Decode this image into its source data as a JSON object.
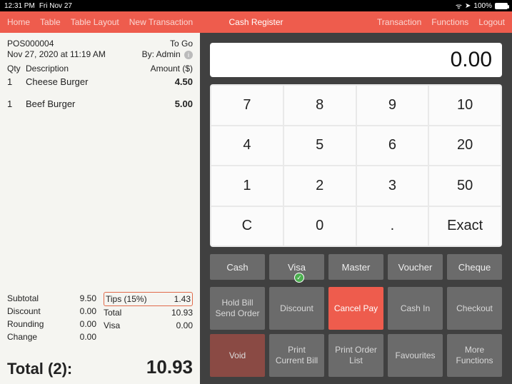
{
  "status": {
    "time": "12:31 PM",
    "date": "Fri Nov 27",
    "battery": "100%"
  },
  "nav": {
    "left": [
      "Home",
      "Table",
      "Table Layout",
      "New Transaction"
    ],
    "title": "Cash Register",
    "right": [
      "Transaction",
      "Functions",
      "Logout"
    ]
  },
  "receipt": {
    "pos_id": "POS000004",
    "order_type": "To Go",
    "datetime": "Nov 27, 2020 at 11:19 AM",
    "by_label": "By: Admin",
    "cols": {
      "qty": "Qty",
      "desc": "Description",
      "amount": "Amount ($)"
    },
    "items": [
      {
        "qty": "1",
        "name": "Cheese Burger",
        "amount": "4.50"
      },
      {
        "qty": "1",
        "name": "Beef Burger",
        "amount": "5.00"
      }
    ],
    "summary_left": [
      {
        "label": "Subtotal",
        "value": "9.50"
      },
      {
        "label": "Discount",
        "value": "0.00"
      },
      {
        "label": "Rounding",
        "value": "0.00"
      },
      {
        "label": "Change",
        "value": "0.00"
      }
    ],
    "summary_right": [
      {
        "label": "Tips (15%)",
        "value": "1.43",
        "highlight": true
      },
      {
        "label": "Total",
        "value": "10.93"
      },
      {
        "label": "Visa",
        "value": "0.00"
      }
    ],
    "total_label": "Total (2):",
    "total_value": "10.93"
  },
  "display_value": "0.00",
  "keypad": [
    "7",
    "8",
    "9",
    "10",
    "4",
    "5",
    "6",
    "20",
    "1",
    "2",
    "3",
    "50",
    "C",
    "0",
    ".",
    "Exact"
  ],
  "payments": [
    "Cash",
    "Visa",
    "Master",
    "Voucher",
    "Cheque"
  ],
  "payments_selected_index": 1,
  "functions": [
    {
      "label": "Hold Bill\nSend Order",
      "style": ""
    },
    {
      "label": "Discount",
      "style": ""
    },
    {
      "label": "Cancel Pay",
      "style": "red"
    },
    {
      "label": "Cash In",
      "style": ""
    },
    {
      "label": "Checkout",
      "style": ""
    },
    {
      "label": "Void",
      "style": "dred"
    },
    {
      "label": "Print\nCurrent Bill",
      "style": ""
    },
    {
      "label": "Print Order\nList",
      "style": ""
    },
    {
      "label": "Favourites",
      "style": ""
    },
    {
      "label": "More\nFunctions",
      "style": ""
    }
  ]
}
